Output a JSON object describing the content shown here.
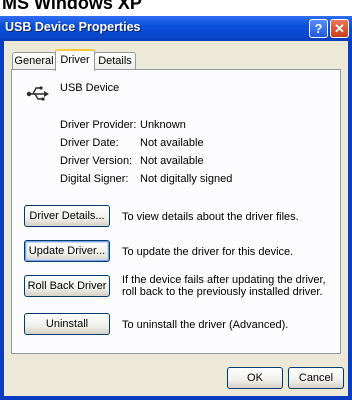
{
  "caption": "MS Windows XP",
  "window": {
    "title": "USB Device Properties",
    "help_glyph": "?",
    "close_glyph": "✕"
  },
  "tabs": [
    {
      "label": "General"
    },
    {
      "label": "Driver",
      "active": true
    },
    {
      "label": "Details"
    }
  ],
  "device": {
    "name": "USB Device",
    "icon": "usb-plug-icon"
  },
  "info": [
    {
      "label": "Driver Provider:",
      "value": "Unknown"
    },
    {
      "label": "Driver Date:",
      "value": "Not available"
    },
    {
      "label": "Driver Version:",
      "value": "Not available"
    },
    {
      "label": "Digital Signer:",
      "value": "Not digitally signed"
    }
  ],
  "actions": [
    {
      "label": "Driver Details...",
      "description": "To view details about the driver files."
    },
    {
      "label": "Update Driver...",
      "description": "To update the driver for this device."
    },
    {
      "label": "Roll Back Driver",
      "description": "If the device fails after updating the driver, roll back to the previously installed driver."
    },
    {
      "label": "Uninstall",
      "description": "To uninstall the driver (Advanced)."
    }
  ],
  "footer": {
    "ok": "OK",
    "cancel": "Cancel"
  },
  "colors": {
    "titlebar": "#0a4fdb",
    "dialog": "#ece9d8",
    "panel": "#fcfcfe",
    "tab_highlight": "#ffc83c"
  }
}
